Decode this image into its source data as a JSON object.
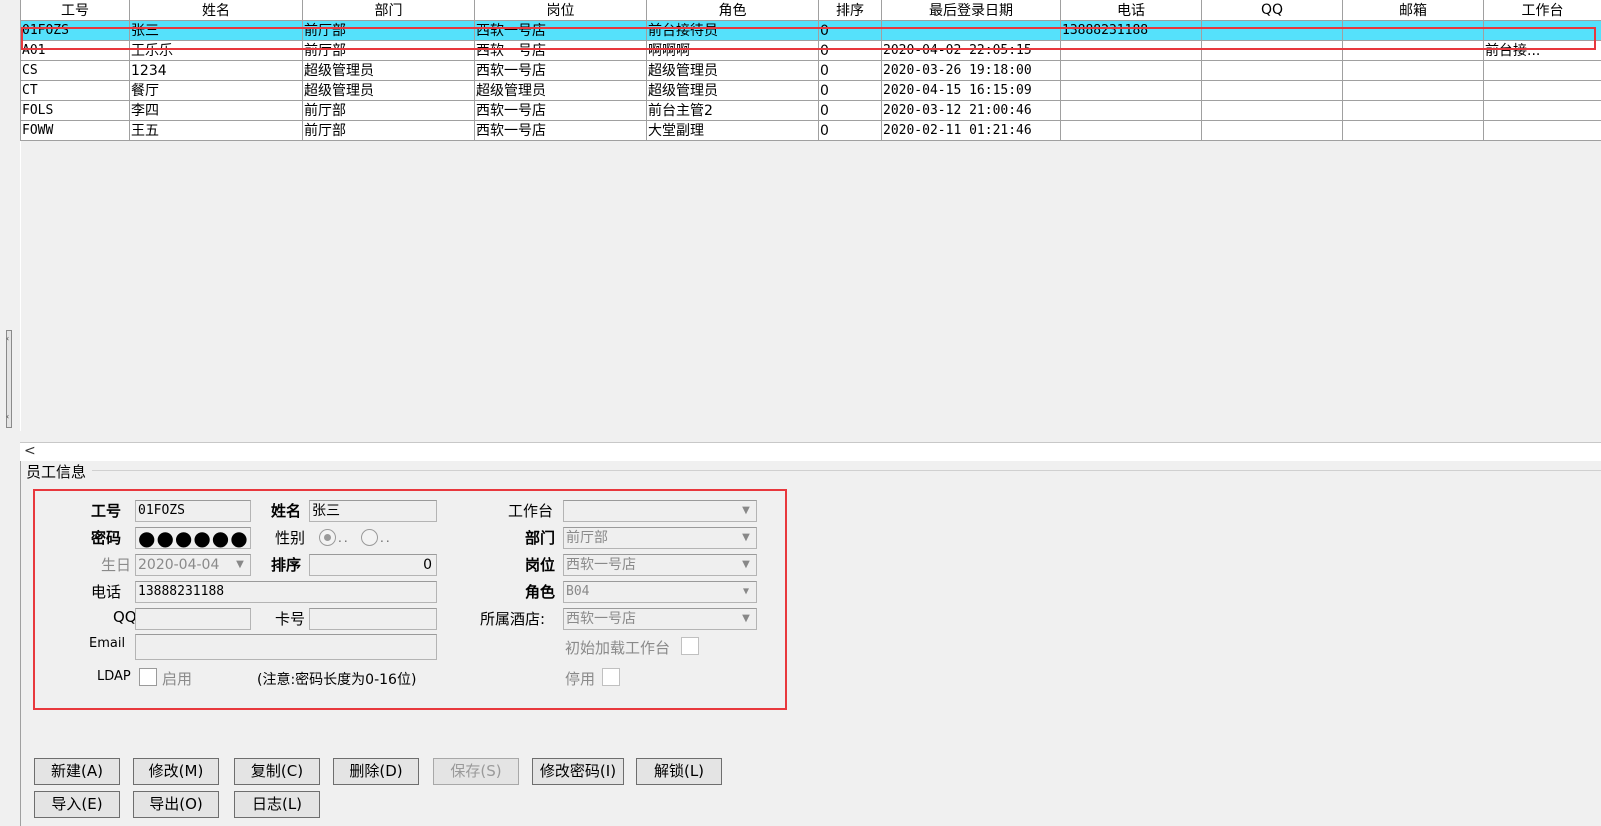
{
  "grid": {
    "headers": [
      "工号",
      "姓名",
      "部门",
      "岗位",
      "角色",
      "排序",
      "最后登录日期",
      "电话",
      "QQ",
      "邮箱",
      "工作台"
    ],
    "rows": [
      [
        "01FOZS",
        "张三",
        "前厅部",
        "西软一号店",
        "前台接待员",
        "0",
        "",
        "13888231188",
        "",
        "",
        ""
      ],
      [
        "A01",
        "王乐乐",
        "前厅部",
        "西软一号店",
        "啊啊啊",
        "0",
        "2020-04-02 22:05:15",
        "",
        "",
        "",
        "前台接..."
      ],
      [
        "CS",
        "1234",
        "超级管理员",
        "西软一号店",
        "超级管理员",
        "0",
        "2020-03-26 19:18:00",
        "",
        "",
        "",
        ""
      ],
      [
        "CT",
        "餐厅",
        "超级管理员",
        "超级管理员",
        "超级管理员",
        "0",
        "2020-04-15 16:15:09",
        "",
        "",
        "",
        ""
      ],
      [
        "FOLS",
        "李四",
        "前厅部",
        "西软一号店",
        "前台主管2",
        "0",
        "2020-03-12 21:00:46",
        "",
        "",
        "",
        ""
      ],
      [
        "FOWW",
        "王五",
        "前厅部",
        "西软一号店",
        "大堂副理",
        "0",
        "2020-02-11 01:21:46",
        "",
        "",
        "",
        ""
      ]
    ],
    "selected_row": 0
  },
  "group_title": "员工信息",
  "form": {
    "id_label": "工号",
    "id_value": "01FOZS",
    "name_label": "姓名",
    "name_value": "张三",
    "password_label": "密码",
    "password_mask": "●●●●●●",
    "gender_label": "性别",
    "gender_opt1": "..",
    "gender_opt2": "..",
    "birthday_label": "生日",
    "birthday_value": "2020-04-04",
    "order_label": "排序",
    "order_value": "0",
    "phone_label": "电话",
    "phone_value": "13888231188",
    "qq_label": "QQ",
    "qq_value": "",
    "card_label": "卡号",
    "card_value": "",
    "email_label": "Email",
    "email_value": "",
    "ldap_label": "LDAP",
    "ldap_enable_label": "启用",
    "note": "(注意:密码长度为0-16位)",
    "workbench_label": "工作台",
    "workbench_value": "",
    "dept_label": "部门",
    "dept_value": "前厅部",
    "post_label": "岗位",
    "post_value": "西软一号店",
    "role_label": "角色",
    "role_value": "B04",
    "hotel_label": "所属酒店:",
    "hotel_value": "西软一号店",
    "init_workbench_label": "初始加载工作台",
    "disabled_label": "停用"
  },
  "buttons": {
    "new": "新建(A)",
    "modify": "修改(M)",
    "copy": "复制(C)",
    "delete": "删除(D)",
    "save": "保存(S)",
    "change_password": "修改密码(I)",
    "unlock": "解锁(L)",
    "import": "导入(E)",
    "export": "导出(O)",
    "log": "日志(L)"
  },
  "colors": {
    "selected_row": "#55e1fb",
    "highlight_border": "#e8383d"
  },
  "icons": {
    "scroll_left": "chevron-left-icon",
    "dropdown": "chevron-down-icon"
  }
}
